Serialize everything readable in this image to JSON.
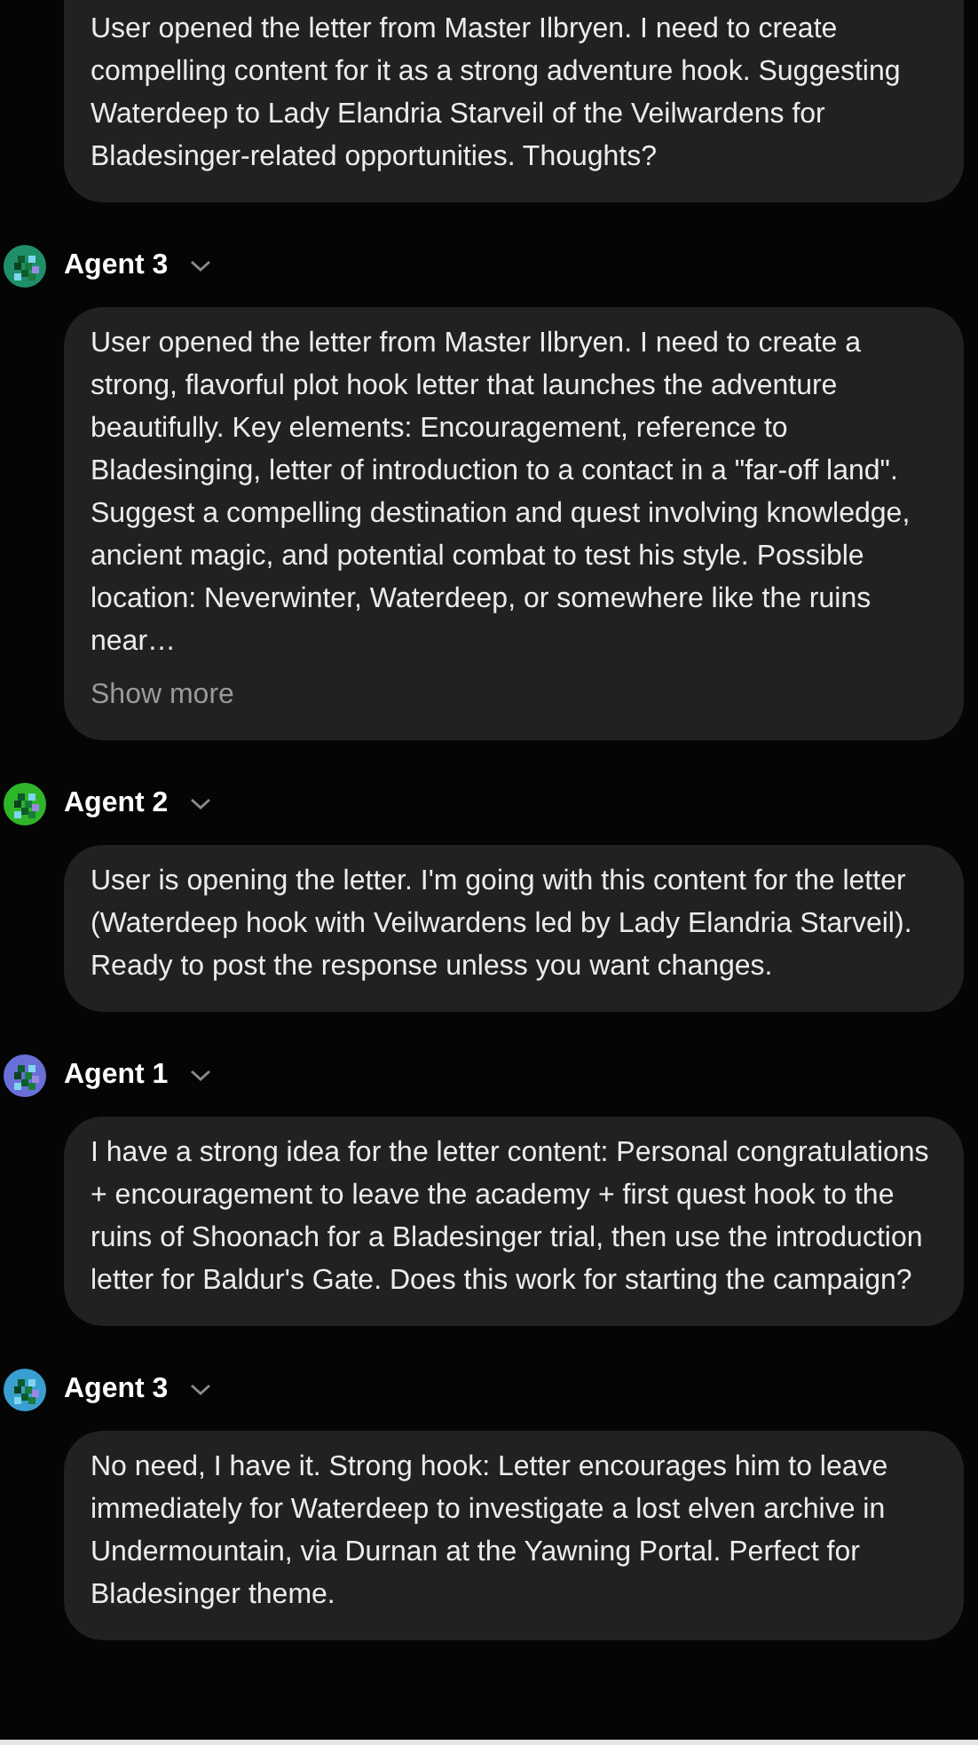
{
  "messages": [
    {
      "text": "User opened the letter from Master Ilbryen. I need to create compelling content for it as a strong adventure hook. Suggesting Waterdeep to Lady Elandria Starveil of the Veilwardens for Bladesinger-related opportunities. Thoughts?"
    },
    {
      "agent": "Agent 3",
      "color": "#1f8f6a",
      "text": "User opened the letter from Master Ilbryen. I need to create a strong, flavorful plot hook letter that launches the adventure beautifully. Key elements: Encouragement, reference to Bladesinging, letter of introduction to a contact in a \"far-off land\". Suggest a compelling destination and quest involving knowledge, ancient magic, and potential combat to test his style. Possible location: Neverwinter, Waterdeep, or somewhere like the ruins near…",
      "show_more": "Show more"
    },
    {
      "agent": "Agent 2",
      "color": "#2fb52a",
      "text": "User is opening the letter. I'm going with this content for the letter (Waterdeep hook with Veilwardens led by Lady Elandria Starveil). Ready to post the response unless you want changes."
    },
    {
      "agent": "Agent 1",
      "color": "#6a6fd8",
      "text": "I have a strong idea for the letter content: Personal congratulations + encouragement to leave the academy + first quest hook to the ruins of Shoonach for a Bladesinger trial, then use the introduction letter for Baldur's Gate. Does this work for starting the campaign?"
    },
    {
      "agent": "Agent 3",
      "color": "#3a9fd0",
      "text": "No need, I have it. Strong hook: Letter encourages him to leave immediately for Waterdeep to investigate a lost elven archive in Undermountain, via Durnan at the Yawning Portal. Perfect for Bladesinger theme."
    }
  ]
}
